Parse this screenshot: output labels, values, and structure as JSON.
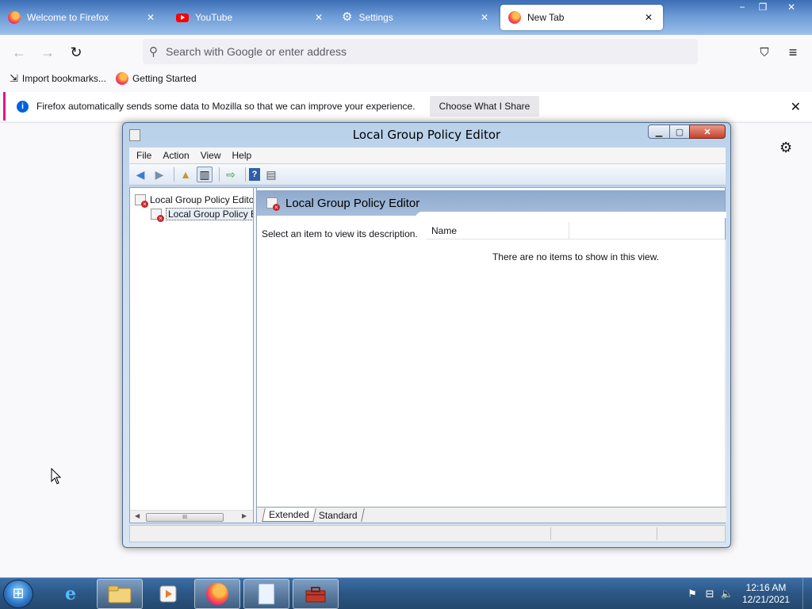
{
  "browser": {
    "tabs": [
      {
        "label": "Welcome to Firefox",
        "icon": "firefox-icon"
      },
      {
        "label": "YouTube",
        "icon": "youtube-icon"
      },
      {
        "label": "Settings",
        "icon": "gear-icon"
      },
      {
        "label": "New Tab",
        "icon": "firefox-icon",
        "selected": true
      }
    ],
    "window_controls": {
      "minimize": "−",
      "restore": "❐",
      "close": "✕"
    },
    "url_placeholder": "Search with Google or enter address",
    "bookmarks": [
      {
        "label": "Import bookmarks...",
        "icon": "import-icon"
      },
      {
        "label": "Getting Started",
        "icon": "firefox-icon"
      }
    ],
    "notification": {
      "text": "Firefox automatically sends some data to Mozilla so that we can improve your experience.",
      "button": "Choose What I Share"
    },
    "accent_color": "#e31587"
  },
  "gpedit": {
    "title": "Local Group Policy Editor",
    "menu": [
      "File",
      "Action",
      "View",
      "Help"
    ],
    "tree": [
      {
        "label": "Local Group Policy Editor"
      },
      {
        "label": "Local Group Policy Editor"
      }
    ],
    "result_header": "Local Group Policy Editor",
    "description": "Select an item to view its description.",
    "column_name": "Name",
    "empty_message": "There are no items to show in this view.",
    "view_tabs": [
      "Extended",
      "Standard"
    ],
    "scroll_thumb": "III"
  },
  "taskbar": {
    "apps": [
      "internet-explorer-icon",
      "file-explorer-icon",
      "media-player-icon",
      "firefox-icon",
      "notepad-icon",
      "toolbox-icon"
    ],
    "clock_time": "12:16 AM",
    "clock_date": "12/21/2021"
  }
}
